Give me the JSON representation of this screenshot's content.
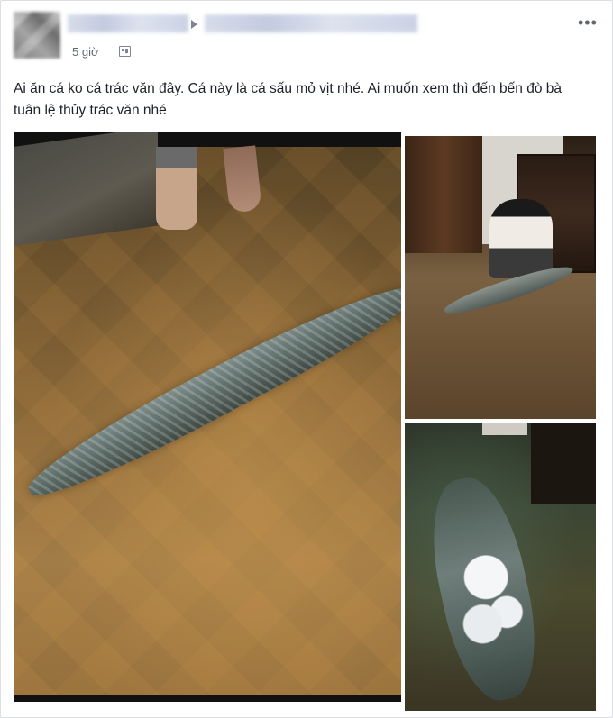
{
  "post": {
    "author_name": "",
    "target_name": "",
    "timestamp": "5 giờ",
    "text": "Ai ăn cá ko cá trác văn đây. Cá này là cá sấu mỏ vịt nhé. Ai muốn xem thì đến bến đò bà tuân lệ thủy trác văn nhé"
  },
  "icons": {
    "privacy": "privacy-icon",
    "more": "more-options-icon",
    "arrow": "share-arrow-icon"
  },
  "photos": {
    "count": 3,
    "items": [
      {
        "name": "main-photo"
      },
      {
        "name": "top-right-photo"
      },
      {
        "name": "bottom-right-photo"
      }
    ]
  }
}
